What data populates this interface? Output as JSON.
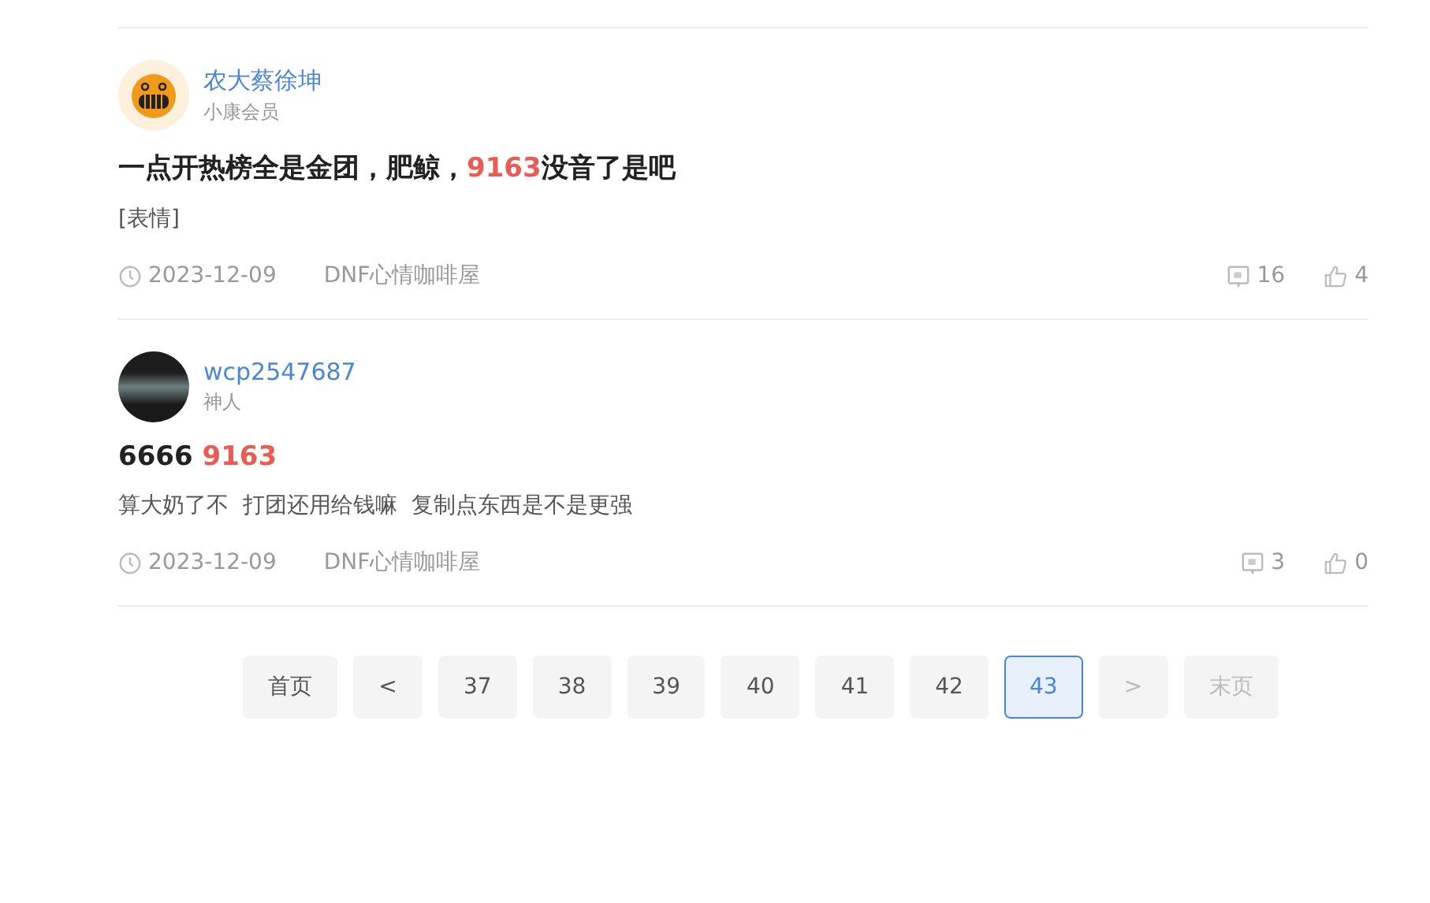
{
  "posts": [
    {
      "avatar": {
        "kind": "emoji"
      },
      "author": "农大蔡徐坤",
      "rank": "小康会员",
      "title": [
        {
          "text": "一点开热榜全是金团，肥鲸，",
          "highlight": false
        },
        {
          "text": "9163",
          "highlight": true
        },
        {
          "text": "没音了是吧",
          "highlight": false
        }
      ],
      "body": "[表情]",
      "date": "2023-12-09",
      "forum": "DNF心情咖啡屋",
      "comments": "16",
      "likes": "4"
    },
    {
      "avatar": {
        "kind": "photo"
      },
      "author": "wcp2547687",
      "rank": "神人",
      "title": [
        {
          "text": "6666 ",
          "highlight": false
        },
        {
          "text": "9163",
          "highlight": true
        }
      ],
      "body": "算大奶了不  打团还用给钱嘛  复制点东西是不是更强",
      "date": "2023-12-09",
      "forum": "DNF心情咖啡屋",
      "comments": "3",
      "likes": "0"
    }
  ],
  "pagination": [
    {
      "label": "首页",
      "selected": false,
      "disabled": false
    },
    {
      "label": "<",
      "selected": false,
      "disabled": false
    },
    {
      "label": "37",
      "selected": false,
      "disabled": false
    },
    {
      "label": "38",
      "selected": false,
      "disabled": false
    },
    {
      "label": "39",
      "selected": false,
      "disabled": false
    },
    {
      "label": "40",
      "selected": false,
      "disabled": false
    },
    {
      "label": "41",
      "selected": false,
      "disabled": false
    },
    {
      "label": "42",
      "selected": false,
      "disabled": false
    },
    {
      "label": "43",
      "selected": true,
      "disabled": false
    },
    {
      "label": ">",
      "selected": false,
      "disabled": true
    },
    {
      "label": "末页",
      "selected": false,
      "disabled": true
    }
  ]
}
